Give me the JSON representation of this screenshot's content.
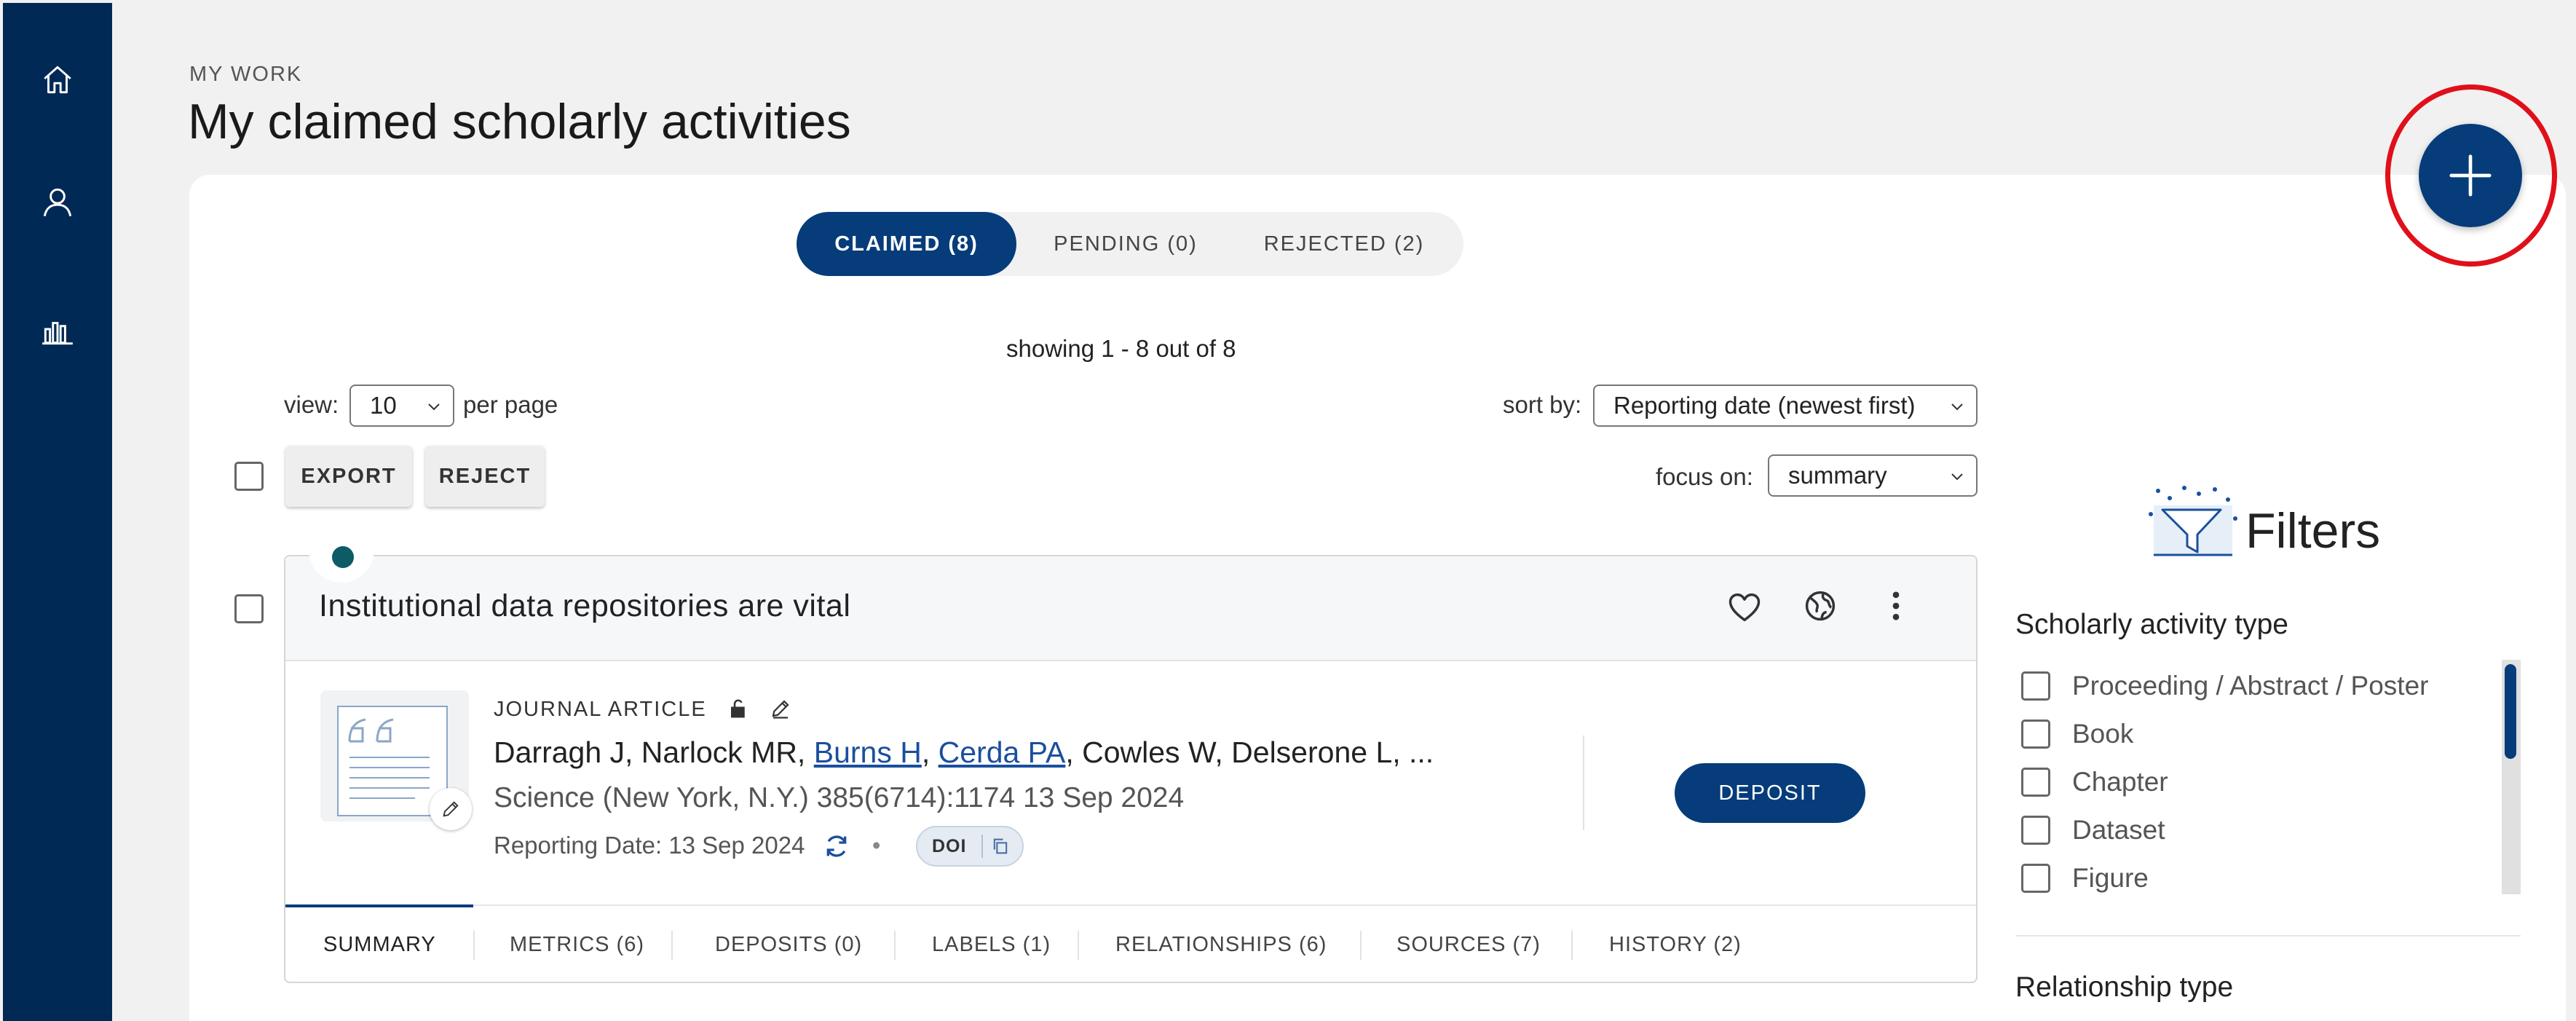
{
  "sidebar": {
    "items": [
      {
        "name": "home",
        "icon": "home-icon"
      },
      {
        "name": "profile",
        "icon": "user-icon"
      },
      {
        "name": "metrics",
        "icon": "bar-chart-icon"
      }
    ]
  },
  "header": {
    "eyebrow": "MY WORK",
    "title": "My claimed scholarly activities"
  },
  "fab": {
    "icon": "plus-icon"
  },
  "tabs": [
    {
      "label": "CLAIMED (8)",
      "active": true
    },
    {
      "label": "PENDING (0)",
      "active": false
    },
    {
      "label": "REJECTED (2)",
      "active": false
    }
  ],
  "showing": "showing 1 - 8 out of 8",
  "view": {
    "label": "view:",
    "value": "10",
    "suffix": "per page"
  },
  "sort": {
    "label": "sort by:",
    "value": "Reporting date (newest first)"
  },
  "focus": {
    "label": "focus on:",
    "value": "summary"
  },
  "actions": {
    "export": "EXPORT",
    "reject": "REJECT"
  },
  "card": {
    "title": "Institutional data repositories are vital",
    "type": "JOURNAL ARTICLE",
    "authors_prefix": "Darragh J, Narlock MR, ",
    "author_link_1": "Burns H",
    "author_sep": ", ",
    "author_link_2": "Cerda PA",
    "authors_suffix": ", Cowles W, Delserone L, ...",
    "source": "Science (New York, N.Y.) 385(6714):1174 13 Sep 2024",
    "reporting_date": "Reporting Date: 13 Sep 2024",
    "bullet": "•",
    "doi": "DOI",
    "deposit": "DEPOSIT",
    "tabs": [
      "SUMMARY",
      "METRICS (6)",
      "DEPOSITS (0)",
      "LABELS (1)",
      "RELATIONSHIPS (6)",
      "SOURCES (7)",
      "HISTORY (2)"
    ]
  },
  "filters": {
    "title": "Filters",
    "activity_type": {
      "heading": "Scholarly activity type",
      "options": [
        "Proceeding / Abstract / Poster",
        "Book",
        "Chapter",
        "Dataset",
        "Figure"
      ]
    },
    "relationship_heading": "Relationship type"
  },
  "colors": {
    "sidebar": "#002a55",
    "primary": "#063c7a",
    "highlight_ring": "#e0101a",
    "status_dot": "#0d5b65"
  }
}
